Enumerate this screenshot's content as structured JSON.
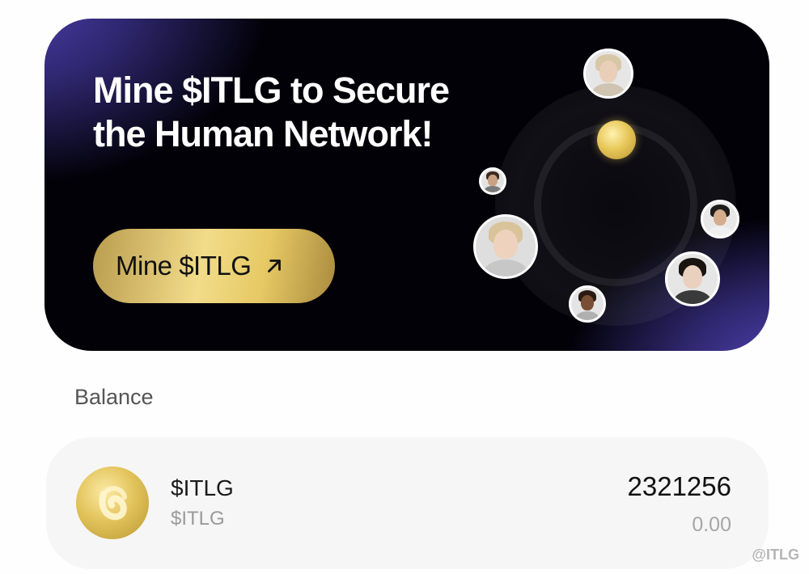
{
  "banner": {
    "title_line1": "Mine $ITLG to Secure",
    "title_line2": "the Human Network!",
    "button_label": "Mine $ITLG",
    "button_icon": "arrow-up-right-icon",
    "accent_gold": "#e6c964",
    "background_purple": "#4b3fb0"
  },
  "balance": {
    "section_label": "Balance",
    "token": {
      "name": "$ITLG",
      "symbol": "$ITLG",
      "amount": "2321256",
      "fiat_value": "0.00",
      "icon": "itlg-coin-icon"
    }
  },
  "watermark": "@ITLG"
}
